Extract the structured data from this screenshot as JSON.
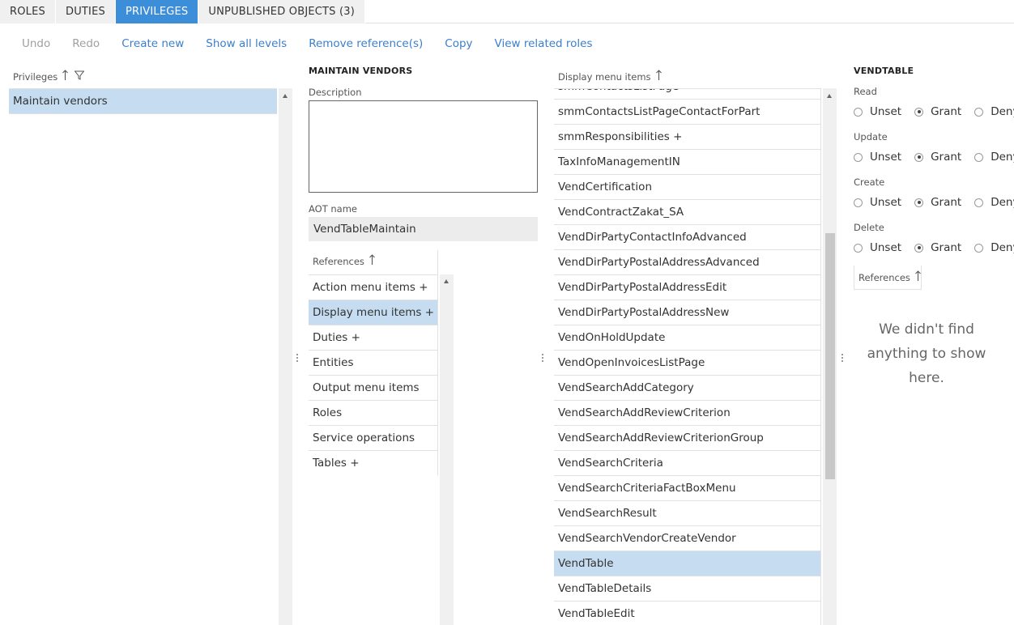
{
  "tabs": [
    {
      "label": "ROLES",
      "active": false
    },
    {
      "label": "DUTIES",
      "active": false
    },
    {
      "label": "PRIVILEGES",
      "active": true
    },
    {
      "label": "UNPUBLISHED OBJECTS (3)",
      "active": false
    }
  ],
  "actions": {
    "undo": "Undo",
    "redo": "Redo",
    "create_new": "Create new",
    "show_all_levels": "Show all levels",
    "remove_references": "Remove reference(s)",
    "copy": "Copy",
    "view_related_roles": "View related roles"
  },
  "privileges_panel": {
    "header": "Privileges",
    "items": [
      "Maintain vendors"
    ]
  },
  "detail_panel": {
    "title": "MAINTAIN VENDORS",
    "description_label": "Description",
    "description_value": "",
    "aot_name_label": "AOT name",
    "aot_name_value": "VendTableMaintain",
    "references_header": "References",
    "references": [
      "Action menu items +",
      "Display menu items +",
      "Duties +",
      "Entities",
      "Output menu items",
      "Roles",
      "Service operations",
      "Tables +"
    ],
    "references_selected": 1
  },
  "display_menu_panel": {
    "header": "Display menu items",
    "partial_top_item": "smmContactsListPage",
    "items": [
      "smmContactsListPageContactForPart",
      "smmResponsibilities +",
      "TaxInfoManagementIN",
      "VendCertification",
      "VendContractZakat_SA",
      "VendDirPartyContactInfoAdvanced",
      "VendDirPartyPostalAddressAdvanced",
      "VendDirPartyPostalAddressEdit",
      "VendDirPartyPostalAddressNew",
      "VendOnHoldUpdate",
      "VendOpenInvoicesListPage",
      "VendSearchAddCategory",
      "VendSearchAddReviewCriterion",
      "VendSearchAddReviewCriterionGroup",
      "VendSearchCriteria",
      "VendSearchCriteriaFactBoxMenu",
      "VendSearchResult",
      "VendSearchVendorCreateVendor",
      "VendTable",
      "VendTableDetails",
      "VendTableEdit"
    ],
    "selected_index": 18
  },
  "permissions_panel": {
    "title": "VENDTABLE",
    "options": [
      "Unset",
      "Grant",
      "Deny"
    ],
    "groups": [
      {
        "label": "Read",
        "value": "Grant"
      },
      {
        "label": "Update",
        "value": "Grant"
      },
      {
        "label": "Create",
        "value": "Grant"
      },
      {
        "label": "Delete",
        "value": "Grant"
      }
    ],
    "references_header": "References",
    "empty_message_line1": "We didn't find",
    "empty_message_line2": "anything to show here."
  }
}
